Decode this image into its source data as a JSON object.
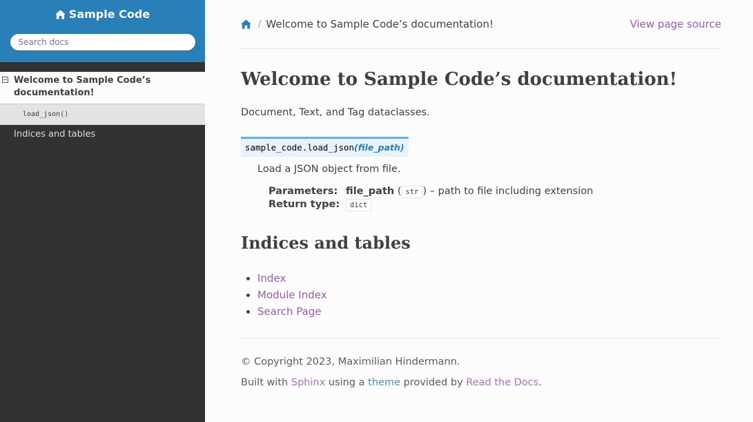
{
  "sidebar": {
    "project_name": "Sample Code",
    "search_placeholder": "Search docs",
    "current_item": "Welcome to Sample Code’s documentation!",
    "sub_item": "load_json()",
    "other_item": "Indices and tables"
  },
  "breadcrumb": {
    "current": "Welcome to Sample Code’s documentation!",
    "separator": "/",
    "view_source": "View page source"
  },
  "content": {
    "title": "Welcome to Sample Code’s documentation!",
    "intro": "Document, Text, and Tag dataclasses.",
    "signature": {
      "module": "sample_code.",
      "name": "load_json",
      "open_paren": "(",
      "param": "file_path",
      "close_paren": ")"
    },
    "description": "Load a JSON object from file.",
    "fields": {
      "parameters_label": "Parameters:",
      "param_name": "file_path",
      "param_type": "str",
      "param_open": "(",
      "param_close": ")",
      "param_desc": " – path to file including extension",
      "return_label": "Return type:",
      "return_type": "dict"
    },
    "section_title": "Indices and tables",
    "index_links": [
      "Index",
      "Module Index",
      "Search Page"
    ]
  },
  "footer": {
    "copyright": "© Copyright 2023, Maximilian Hindermann.",
    "built_with": "Built with ",
    "sphinx": "Sphinx",
    "using_a": " using a ",
    "theme": "theme",
    "provided_by": " provided by ",
    "rtd": "Read the Docs",
    "period": "."
  },
  "colors": {
    "sidebar_bg": "#343131",
    "sidebar_top": "#2980b9",
    "link_purple": "#9b59b6",
    "link_blue": "#2980b9"
  },
  "icons": [
    "home-icon",
    "toggle-collapse-icon"
  ]
}
